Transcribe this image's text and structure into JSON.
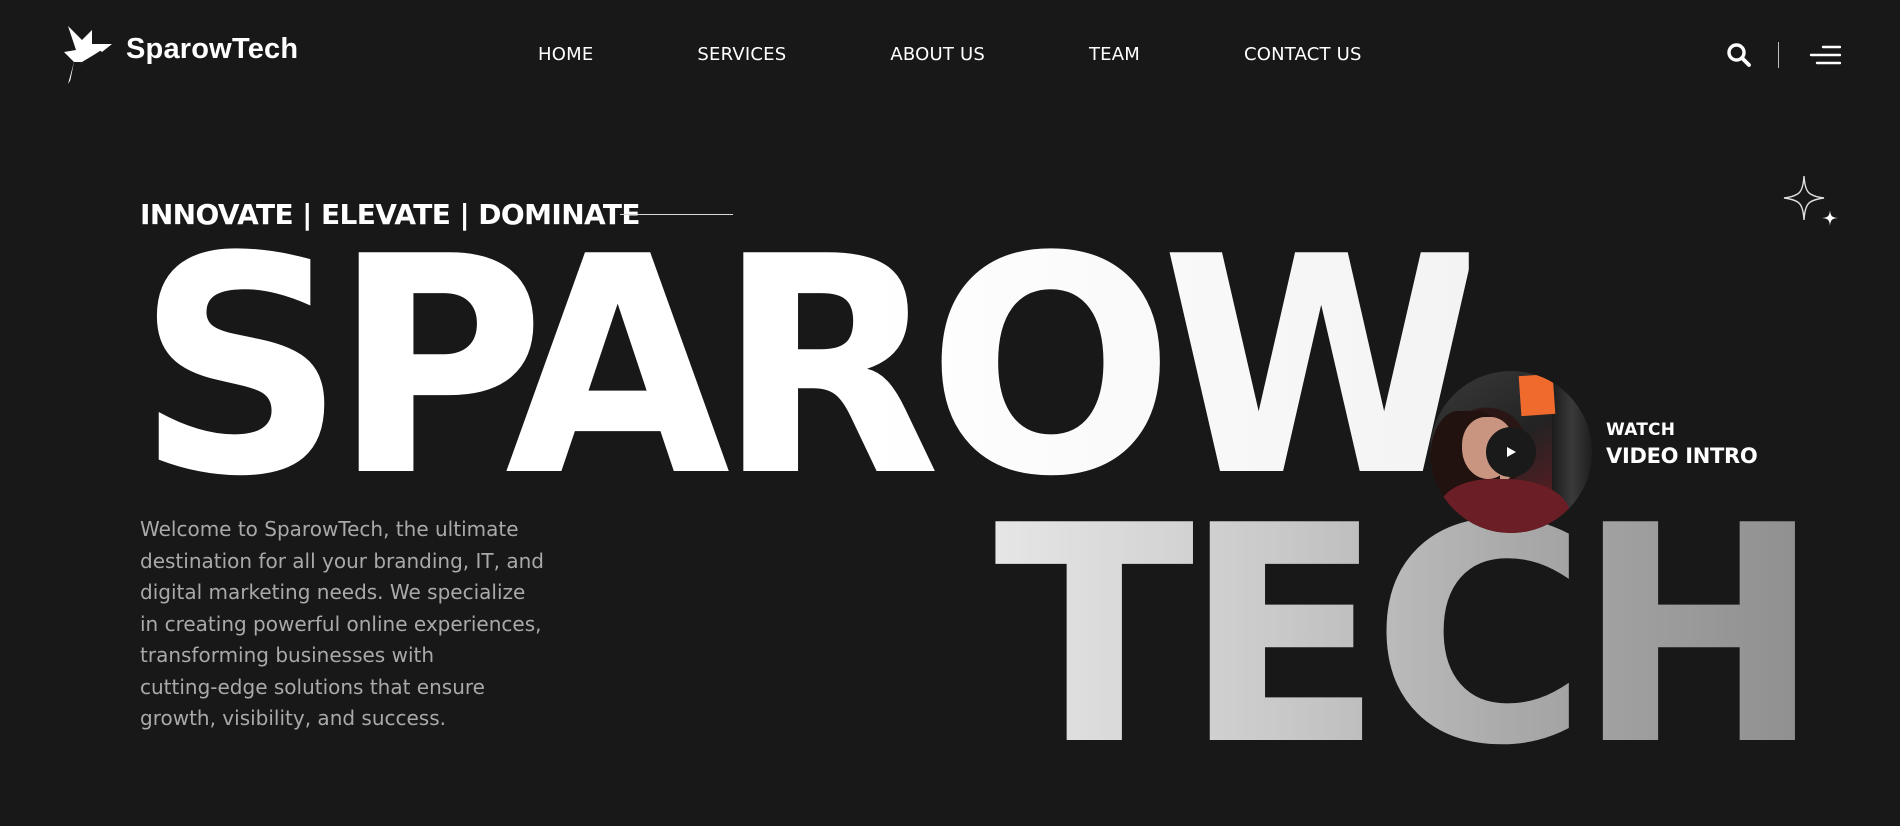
{
  "brand": {
    "name": "SparowTech"
  },
  "nav": {
    "items": [
      {
        "label": "HOME"
      },
      {
        "label": "SERVICES"
      },
      {
        "label": "ABOUT US"
      },
      {
        "label": "TEAM"
      },
      {
        "label": "CONTACT US"
      }
    ]
  },
  "header_tools": {
    "search_icon": "search-icon",
    "menu_icon": "hamburger-menu-icon"
  },
  "hero": {
    "tagline": "INNOVATE | ELEVATE | DOMINATE",
    "headline_line1": "SPAROW",
    "headline_line2": "TECH",
    "intro": "Welcome to SparowTech, the ultimate\ndestination for all your branding, IT, and\n digital marketing needs. We specialize\nin creating powerful online experiences,\n transforming businesses with\ncutting-edge solutions that ensure\ngrowth, visibility, and success."
  },
  "video": {
    "watch_label": "WATCH",
    "title": "VIDEO INTRO",
    "play_icon": "play-icon"
  },
  "decor": {
    "sparkle_icon": "sparkle-icon"
  },
  "colors": {
    "background": "#181818",
    "text": "#ffffff",
    "muted_text": "#a9a9a9",
    "accent_note": "#f06a2e"
  }
}
